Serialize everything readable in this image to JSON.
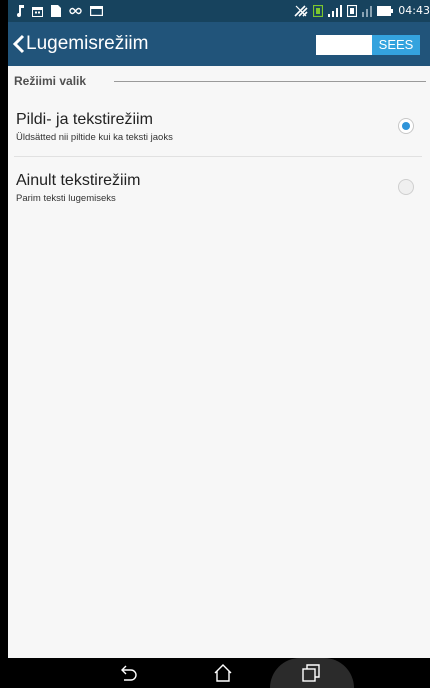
{
  "status_bar": {
    "time": "04:43",
    "left_icons": [
      "music-note-icon",
      "calendar-icon",
      "file-icon",
      "infinity-icon",
      "message-icon"
    ],
    "right_icons": [
      "no-signal-icon",
      "sim-1-icon",
      "signal-bars-icon",
      "sim-2-icon",
      "signal-bars-2-icon",
      "battery-icon"
    ]
  },
  "app_bar": {
    "title": "Lugemisrežiim",
    "toggle_label": "SEES",
    "toggle_state": "on"
  },
  "section": {
    "header": "Režiimi valik"
  },
  "options": [
    {
      "title": "Pildi- ja tekstirežiim",
      "subtitle": "Üldsätted nii piltide kui ka teksti jaoks",
      "selected": true
    },
    {
      "title": "Ainult tekstirežiim",
      "subtitle": "Parim teksti lugemiseks",
      "selected": false
    }
  ],
  "nav_bar": {
    "buttons": [
      "back-icon",
      "home-icon",
      "recent-apps-icon"
    ]
  },
  "colors": {
    "status_bar": "#17435e",
    "app_bar": "#21547a",
    "accent": "#34a3de",
    "radio_selected": "#2f94d9",
    "background": "#f7f7f7"
  }
}
